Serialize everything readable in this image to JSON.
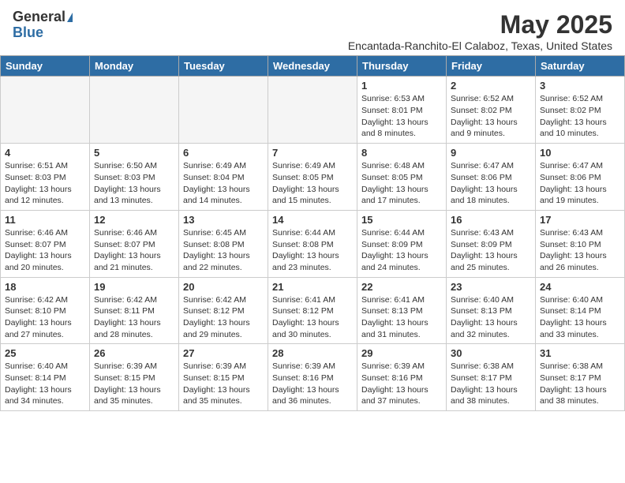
{
  "header": {
    "logo_general": "General",
    "logo_blue": "Blue",
    "month_title": "May 2025",
    "subtitle": "Encantada-Ranchito-El Calaboz, Texas, United States"
  },
  "days_of_week": [
    "Sunday",
    "Monday",
    "Tuesday",
    "Wednesday",
    "Thursday",
    "Friday",
    "Saturday"
  ],
  "weeks": [
    [
      {
        "day": "",
        "detail": ""
      },
      {
        "day": "",
        "detail": ""
      },
      {
        "day": "",
        "detail": ""
      },
      {
        "day": "",
        "detail": ""
      },
      {
        "day": "1",
        "detail": "Sunrise: 6:53 AM\nSunset: 8:01 PM\nDaylight: 13 hours and 8 minutes."
      },
      {
        "day": "2",
        "detail": "Sunrise: 6:52 AM\nSunset: 8:02 PM\nDaylight: 13 hours and 9 minutes."
      },
      {
        "day": "3",
        "detail": "Sunrise: 6:52 AM\nSunset: 8:02 PM\nDaylight: 13 hours and 10 minutes."
      }
    ],
    [
      {
        "day": "4",
        "detail": "Sunrise: 6:51 AM\nSunset: 8:03 PM\nDaylight: 13 hours and 12 minutes."
      },
      {
        "day": "5",
        "detail": "Sunrise: 6:50 AM\nSunset: 8:03 PM\nDaylight: 13 hours and 13 minutes."
      },
      {
        "day": "6",
        "detail": "Sunrise: 6:49 AM\nSunset: 8:04 PM\nDaylight: 13 hours and 14 minutes."
      },
      {
        "day": "7",
        "detail": "Sunrise: 6:49 AM\nSunset: 8:05 PM\nDaylight: 13 hours and 15 minutes."
      },
      {
        "day": "8",
        "detail": "Sunrise: 6:48 AM\nSunset: 8:05 PM\nDaylight: 13 hours and 17 minutes."
      },
      {
        "day": "9",
        "detail": "Sunrise: 6:47 AM\nSunset: 8:06 PM\nDaylight: 13 hours and 18 minutes."
      },
      {
        "day": "10",
        "detail": "Sunrise: 6:47 AM\nSunset: 8:06 PM\nDaylight: 13 hours and 19 minutes."
      }
    ],
    [
      {
        "day": "11",
        "detail": "Sunrise: 6:46 AM\nSunset: 8:07 PM\nDaylight: 13 hours and 20 minutes."
      },
      {
        "day": "12",
        "detail": "Sunrise: 6:46 AM\nSunset: 8:07 PM\nDaylight: 13 hours and 21 minutes."
      },
      {
        "day": "13",
        "detail": "Sunrise: 6:45 AM\nSunset: 8:08 PM\nDaylight: 13 hours and 22 minutes."
      },
      {
        "day": "14",
        "detail": "Sunrise: 6:44 AM\nSunset: 8:08 PM\nDaylight: 13 hours and 23 minutes."
      },
      {
        "day": "15",
        "detail": "Sunrise: 6:44 AM\nSunset: 8:09 PM\nDaylight: 13 hours and 24 minutes."
      },
      {
        "day": "16",
        "detail": "Sunrise: 6:43 AM\nSunset: 8:09 PM\nDaylight: 13 hours and 25 minutes."
      },
      {
        "day": "17",
        "detail": "Sunrise: 6:43 AM\nSunset: 8:10 PM\nDaylight: 13 hours and 26 minutes."
      }
    ],
    [
      {
        "day": "18",
        "detail": "Sunrise: 6:42 AM\nSunset: 8:10 PM\nDaylight: 13 hours and 27 minutes."
      },
      {
        "day": "19",
        "detail": "Sunrise: 6:42 AM\nSunset: 8:11 PM\nDaylight: 13 hours and 28 minutes."
      },
      {
        "day": "20",
        "detail": "Sunrise: 6:42 AM\nSunset: 8:12 PM\nDaylight: 13 hours and 29 minutes."
      },
      {
        "day": "21",
        "detail": "Sunrise: 6:41 AM\nSunset: 8:12 PM\nDaylight: 13 hours and 30 minutes."
      },
      {
        "day": "22",
        "detail": "Sunrise: 6:41 AM\nSunset: 8:13 PM\nDaylight: 13 hours and 31 minutes."
      },
      {
        "day": "23",
        "detail": "Sunrise: 6:40 AM\nSunset: 8:13 PM\nDaylight: 13 hours and 32 minutes."
      },
      {
        "day": "24",
        "detail": "Sunrise: 6:40 AM\nSunset: 8:14 PM\nDaylight: 13 hours and 33 minutes."
      }
    ],
    [
      {
        "day": "25",
        "detail": "Sunrise: 6:40 AM\nSunset: 8:14 PM\nDaylight: 13 hours and 34 minutes."
      },
      {
        "day": "26",
        "detail": "Sunrise: 6:39 AM\nSunset: 8:15 PM\nDaylight: 13 hours and 35 minutes."
      },
      {
        "day": "27",
        "detail": "Sunrise: 6:39 AM\nSunset: 8:15 PM\nDaylight: 13 hours and 35 minutes."
      },
      {
        "day": "28",
        "detail": "Sunrise: 6:39 AM\nSunset: 8:16 PM\nDaylight: 13 hours and 36 minutes."
      },
      {
        "day": "29",
        "detail": "Sunrise: 6:39 AM\nSunset: 8:16 PM\nDaylight: 13 hours and 37 minutes."
      },
      {
        "day": "30",
        "detail": "Sunrise: 6:38 AM\nSunset: 8:17 PM\nDaylight: 13 hours and 38 minutes."
      },
      {
        "day": "31",
        "detail": "Sunrise: 6:38 AM\nSunset: 8:17 PM\nDaylight: 13 hours and 38 minutes."
      }
    ]
  ]
}
